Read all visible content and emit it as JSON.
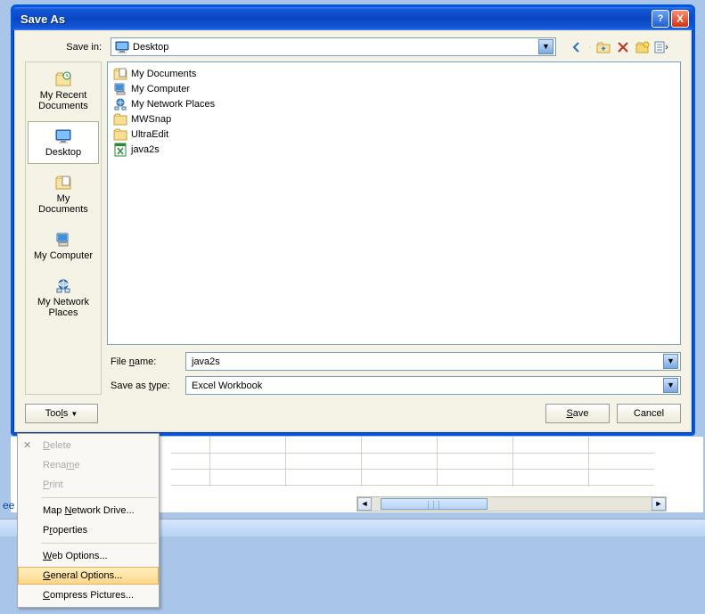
{
  "titlebar": {
    "title": "Save As",
    "help": "?",
    "close": "X"
  },
  "save_in_label": "Save in:",
  "save_in_value": "Desktop",
  "places": [
    {
      "label": "My Recent Documents",
      "icon": "recent-icon"
    },
    {
      "label": "Desktop",
      "icon": "desktop-icon",
      "selected": true
    },
    {
      "label": "My Documents",
      "icon": "mydocs-icon"
    },
    {
      "label": "My Computer",
      "icon": "mycomputer-icon"
    },
    {
      "label": "My Network Places",
      "icon": "network-icon"
    }
  ],
  "files": [
    {
      "name": "My Documents",
      "icon": "mydocs-icon"
    },
    {
      "name": "My Computer",
      "icon": "mycomputer-icon"
    },
    {
      "name": "My Network Places",
      "icon": "network-icon"
    },
    {
      "name": "MWSnap",
      "icon": "folder-icon"
    },
    {
      "name": "UltraEdit",
      "icon": "folder-icon"
    },
    {
      "name": "java2s",
      "icon": "excel-icon"
    }
  ],
  "filename_label": "File name:",
  "filename_value": "java2s",
  "saveastype_label": "Save as type:",
  "saveastype_value": "Excel Workbook",
  "tools_label": "Tools",
  "save_label": "Save",
  "cancel_label": "Cancel",
  "tools_menu": {
    "delete": "Delete",
    "rename": "Rename",
    "print": "Print",
    "map_drive": "Map Network Drive...",
    "properties": "Properties",
    "web_options": "Web Options...",
    "general_options": "General Options...",
    "compress": "Compress Pictures..."
  },
  "sheet_link": "ee"
}
